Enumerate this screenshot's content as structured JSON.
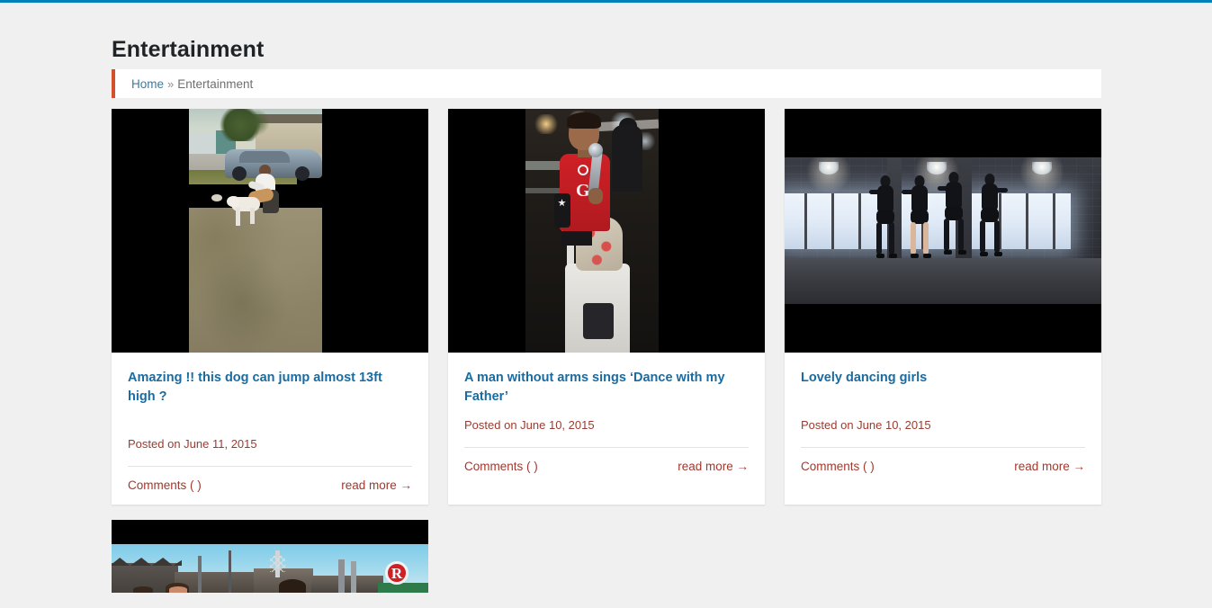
{
  "site": {
    "accent_top_bar_color": "#0081bc",
    "background_color": "#f0f0f0",
    "link_color": "#1a6ba0",
    "meta_color": "#9c3b2f",
    "breadcrumb_accent_color": "#d4502a"
  },
  "header": {
    "page_title": "Entertainment"
  },
  "breadcrumb": {
    "home_label": "Home",
    "separator": "»",
    "current_label": "Entertainment"
  },
  "posts": [
    {
      "title": "Amazing !! this dog can jump almost 13ft high ?",
      "posted_prefix": "Posted on",
      "date": "June 11, 2015",
      "comments_label": "Comments ( )",
      "read_more_label": "read more →",
      "thumbnail": "video-thumbnail-dog-jump"
    },
    {
      "title": "A man without arms sings ‘Dance with my Father’",
      "posted_prefix": "Posted on",
      "date": "June 10, 2015",
      "comments_label": "Comments ( )",
      "read_more_label": "read more →",
      "thumbnail": "video-thumbnail-singer"
    },
    {
      "title": "Lovely dancing girls",
      "posted_prefix": "Posted on",
      "date": "June 10, 2015",
      "comments_label": "Comments ( )",
      "read_more_label": "read more →",
      "thumbnail": "video-thumbnail-dancers"
    },
    {
      "title": "",
      "posted_prefix": "",
      "date": "",
      "comments_label": "",
      "read_more_label": "",
      "thumbnail": "video-thumbnail-street"
    }
  ],
  "icons": {
    "r_badge": "R",
    "shirt_letter": "G"
  }
}
